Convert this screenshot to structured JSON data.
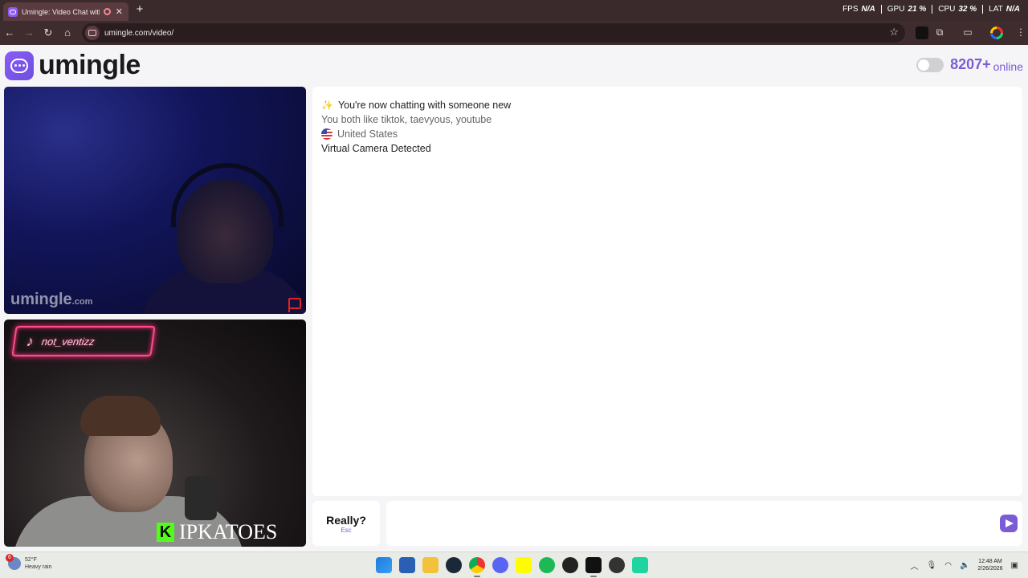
{
  "browser": {
    "tab_title": "Umingle: Video Chat with S",
    "new_tab": "+",
    "tab_close": "✕",
    "url": "umingle.com/video/",
    "perf": [
      {
        "label": "FPS",
        "value": "N/A"
      },
      {
        "label": "GPU",
        "value": "21 %"
      },
      {
        "label": "CPU",
        "value": "32 %"
      },
      {
        "label": "LAT",
        "value": "N/A"
      }
    ]
  },
  "site": {
    "logo_text": "umingle",
    "online_count": "8207+",
    "online_label": "online",
    "toggle_on": false
  },
  "video": {
    "remote_watermark": "umingle",
    "remote_watermark_suffix": ".com",
    "tiktok_handle": "not_ventizz",
    "kick_letter": "K",
    "kick_name": "IPKATOES"
  },
  "chat": {
    "line1": "You're now chatting with someone new",
    "line2": "You both like tiktok, taevyous, youtube",
    "country": "United States",
    "line4": "Virtual Camera Detected"
  },
  "controls": {
    "skip_label": "Really?",
    "skip_key": "Esc",
    "message_value": ""
  },
  "taskbar": {
    "weather_badge": "6",
    "temperature": "52°F",
    "condition": "Heavy rain",
    "time": "12:48 AM",
    "date": "2/26/2026"
  },
  "colors": {
    "accent": "#7b5cd6",
    "browser_frame": "#3a2a2c",
    "neon": "#ff4d8d",
    "kick_green": "#53fc18"
  }
}
